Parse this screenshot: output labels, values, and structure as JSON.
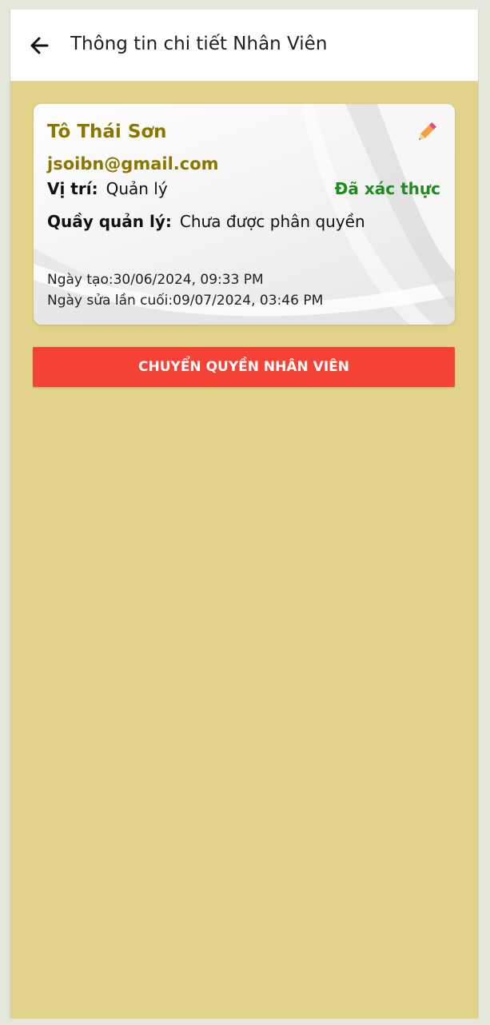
{
  "header": {
    "title": "Thông tin chi tiết Nhân Viên"
  },
  "employee": {
    "name": "Tô Thái Sơn",
    "email": "jsoibn@gmail.com",
    "role_label": "Vị trí:",
    "role_value": "Quản lý",
    "status": "Đã xác thực",
    "counter_label": "Quầy quản lý:",
    "counter_value": "Chưa được phân quyền",
    "created": "Ngày tạo:30/06/2024, 09:33 PM",
    "modified": "Ngày sửa lần cuối:09/07/2024, 03:46 PM"
  },
  "actions": {
    "transfer_label": "CHUYỂN QUYỀN NHÂN VIÊN"
  },
  "colors": {
    "background": "#e0d389",
    "accent_text": "#8a7700",
    "status_verified": "#1e8c1e",
    "button": "#f44336"
  },
  "icons": {
    "back": "arrow-left-icon",
    "edit": "pencil-icon"
  }
}
